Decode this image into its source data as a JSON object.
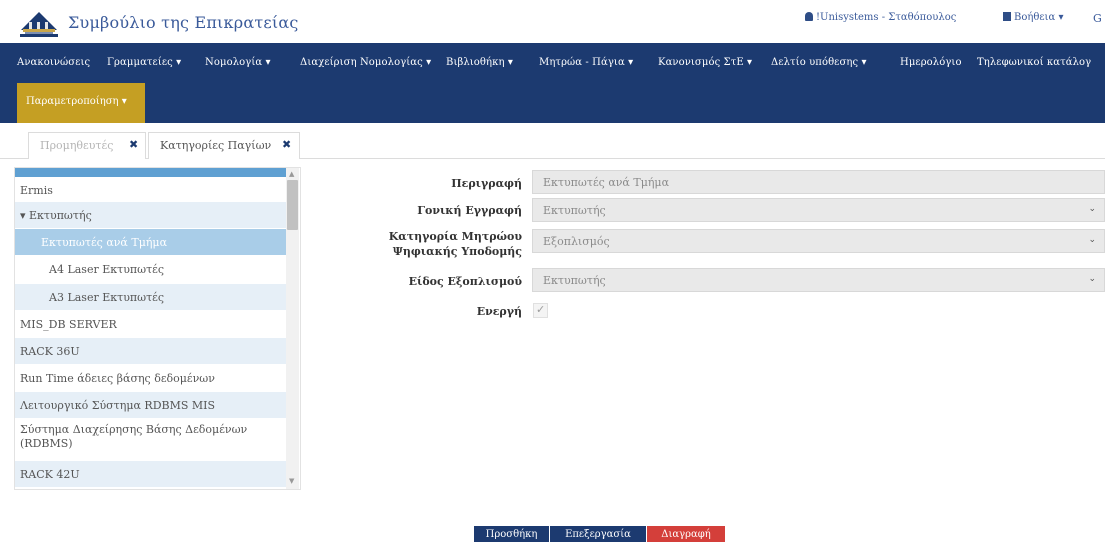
{
  "header": {
    "brand": "Συμβούλιο της Επικρατείας",
    "user": "!Unisystems - Σταθόπουλος",
    "help": "Βοήθεια",
    "help_caret": "▾",
    "extra_letter": "G"
  },
  "nav": {
    "items": [
      "Ανακοινώσεις",
      "Γραμματείες ▾",
      "Νομολογία ▾",
      "Διαχείριση Νομολογίας ▾",
      "Βιβλιοθήκη ▾",
      "Μητρώα - Πάγια ▾",
      "Κανονισμός ΣτΕ ▾",
      "Δελτίο υπόθεσης ▾",
      "Ημερολόγιο",
      "Τηλεφωνικοί κατάλογ"
    ],
    "active": "Παραμετροποίηση ▾"
  },
  "tabs": [
    {
      "label": "Προμηθευτές",
      "close": "✖"
    },
    {
      "label": "Κατηγορίες Παγίων",
      "close": "✖"
    }
  ],
  "tree": {
    "items": [
      {
        "label": "Ermis",
        "indent": 0
      },
      {
        "label": "▾ Εκτυπωτής",
        "indent": 0
      },
      {
        "label": "Εκτυπωτές ανά Τμήμα",
        "indent": 1
      },
      {
        "label": "A4 Laser Εκτυπωτές",
        "indent": 1
      },
      {
        "label": "A3 Laser Εκτυπωτές",
        "indent": 1
      },
      {
        "label": "MIS_DB SERVER",
        "indent": 0
      },
      {
        "label": "RACK 36U",
        "indent": 0
      },
      {
        "label": "Run Time άδειες βάσης δεδομένων",
        "indent": 0
      },
      {
        "label": "Λειτουργικό Σύστημα RDBMS MIS",
        "indent": 0
      },
      {
        "label": "Σύστημα Διαχείρησης Βάσης Δεδομένων (RDBMS)",
        "indent": 0
      },
      {
        "label": "RACK 42U",
        "indent": 0
      }
    ],
    "scroll_up": "▲",
    "scroll_down": "▼"
  },
  "form": {
    "description_label": "Περιγραφή",
    "description_value": "Εκτυπωτές ανά Τμήμα",
    "parent_label": "Γονική Εγγραφή",
    "parent_value": "Εκτυπωτής",
    "category_label": "Κατηγορία Μητρώου Ψηφιακής Υποδομής",
    "category_value": "Εξοπλισμός",
    "equipment_label": "Είδος Εξοπλισμού",
    "equipment_value": "Εκτυπωτής",
    "active_label": "Ενεργή",
    "active_mark": "✓",
    "chevron": "⌄"
  },
  "buttons": {
    "add": "Προσθήκη",
    "edit": "Επεξεργασία",
    "delete": "Διαγραφή"
  },
  "colors": {
    "navbar": "#1c3a70",
    "active_menu": "#c59f23",
    "tree_selected": "#a9cde8",
    "btn_primary": "#1c3a70",
    "btn_danger": "#d43f3a"
  }
}
